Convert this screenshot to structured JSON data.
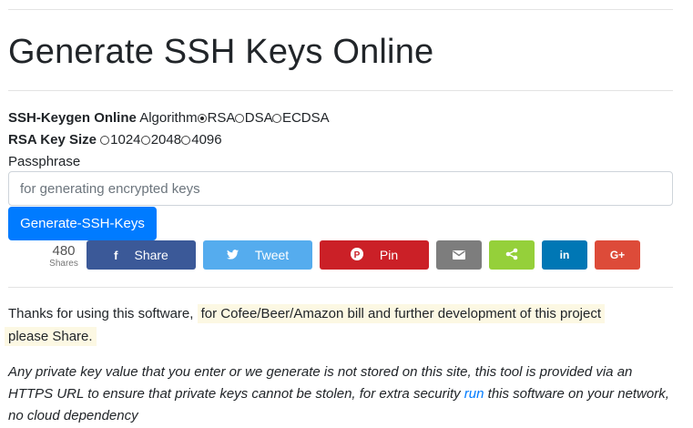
{
  "page": {
    "title": "Generate SSH Keys Online"
  },
  "form": {
    "keygen_label": "SSH-Keygen Online",
    "algorithm_label": "Algorithm",
    "algorithms": [
      {
        "label": "RSA",
        "selected": true
      },
      {
        "label": "DSA",
        "selected": false
      },
      {
        "label": "ECDSA",
        "selected": false
      }
    ],
    "key_size_label": "RSA Key Size",
    "key_sizes": [
      {
        "label": "1024",
        "selected": false
      },
      {
        "label": "2048",
        "selected": false
      },
      {
        "label": "4096",
        "selected": false
      }
    ],
    "passphrase_label": "Passphrase",
    "passphrase_value": "",
    "passphrase_placeholder": "for generating encrypted keys",
    "generate_button": "Generate-SSH-Keys"
  },
  "share": {
    "count": "480",
    "count_label": "Shares",
    "buttons": [
      {
        "name": "facebook",
        "label": "Share",
        "icon": "f",
        "color": "#3b5998"
      },
      {
        "name": "twitter",
        "label": "Tweet",
        "icon": "twitter-bird",
        "color": "#55acee"
      },
      {
        "name": "pinterest",
        "label": "Pin",
        "icon": "P",
        "color": "#cb2027"
      },
      {
        "name": "email",
        "label": "",
        "icon": "envelope",
        "color": "#7d7d7d"
      },
      {
        "name": "share",
        "label": "",
        "icon": "share-nodes",
        "color": "#95d03a"
      },
      {
        "name": "linkedin",
        "label": "",
        "icon": "in",
        "color": "#0077b5"
      },
      {
        "name": "googleplus",
        "label": "",
        "icon": "G+",
        "color": "#dd4b39"
      }
    ]
  },
  "thanks": {
    "prefix": "Thanks for using this software,",
    "highlight_line1": "for Cofee/Beer/Amazon bill and further development of this project",
    "highlight_line2": "please Share."
  },
  "note": {
    "text_before": "Any private key value that you enter or we generate is not stored on this site, this tool is provided via an HTTPS URL to ensure that private keys cannot be stolen, for extra security",
    "link": "run",
    "text_after": "this software on your network, no cloud dependency"
  }
}
